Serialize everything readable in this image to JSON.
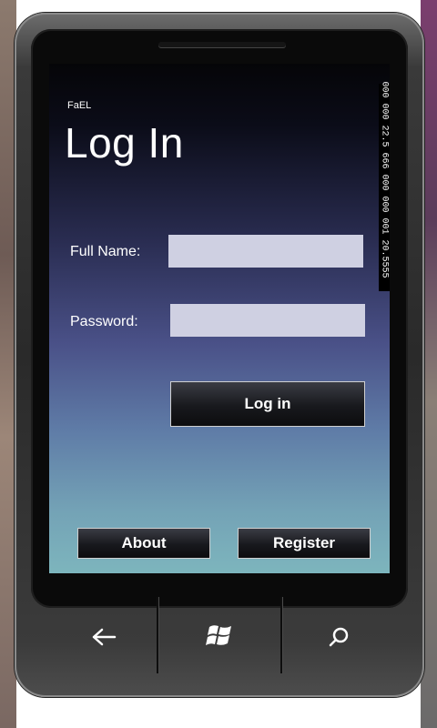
{
  "app": {
    "name": "FaEL"
  },
  "page": {
    "title": "Log In"
  },
  "form": {
    "full_name_label": "Full Name:",
    "full_name_value": "",
    "password_label": "Password:",
    "password_value": "",
    "login_button": "Log in"
  },
  "footer": {
    "about_button": "About",
    "register_button": "Register"
  },
  "debug": {
    "counter_text": "000 000 22.5 666 000 000 001 20.5555"
  },
  "nav": {
    "back": "back-icon",
    "start": "windows-logo-icon",
    "search": "search-icon"
  },
  "colors": {
    "input_background": "#cfd0e2",
    "screen_top": "#050508",
    "screen_bottom": "#7db5bd"
  }
}
